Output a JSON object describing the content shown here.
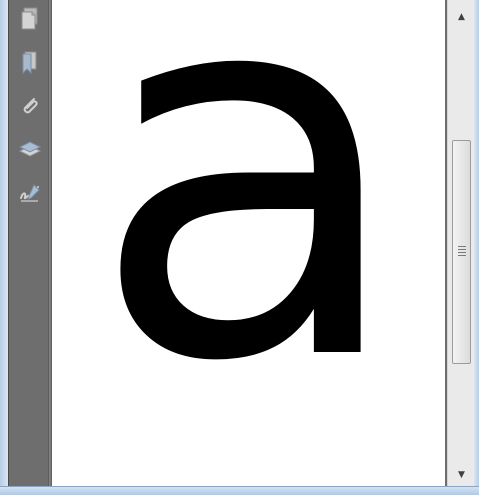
{
  "window": {
    "frame_color": "#c9dcef",
    "nav_pane_color": "#6e6e6e",
    "page_background": "#ffffff"
  },
  "nav_pane": {
    "buttons": [
      {
        "icon": "pages-icon"
      },
      {
        "icon": "bookmark-icon"
      },
      {
        "icon": "attachment-icon"
      },
      {
        "icon": "layers-icon"
      },
      {
        "icon": "signature-icon"
      }
    ]
  },
  "document": {
    "glyph": "a"
  },
  "scrollbar": {
    "up_arrow": "▲",
    "down_arrow": "▼"
  }
}
